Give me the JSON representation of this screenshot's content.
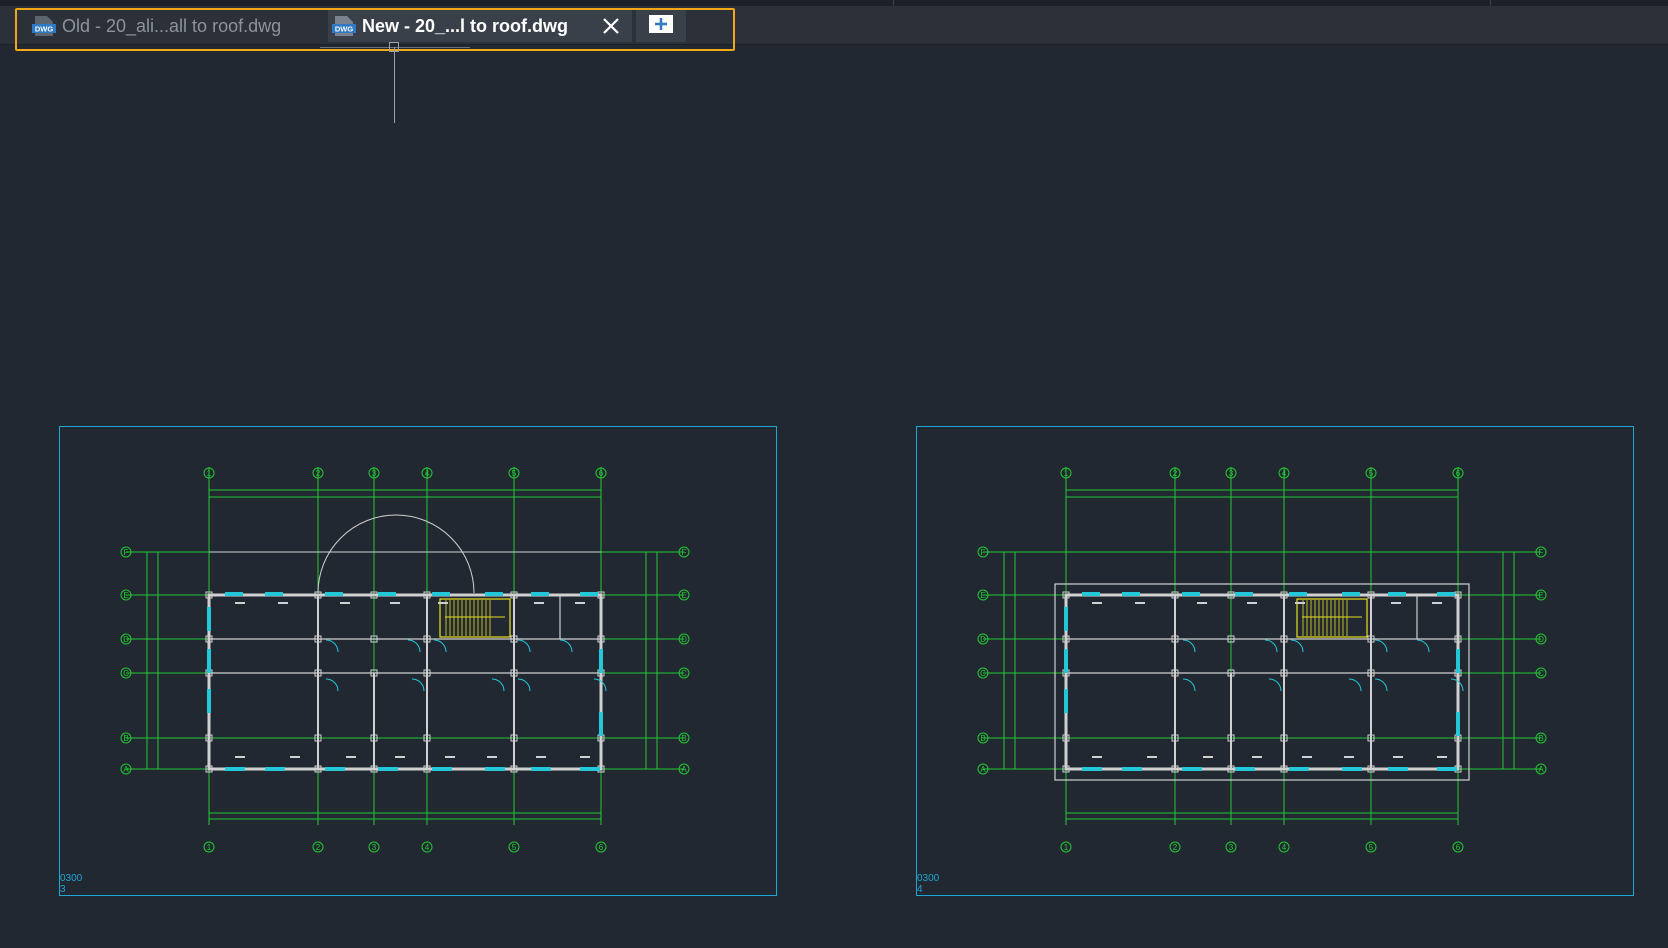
{
  "tabs": [
    {
      "label": "Old - 20_ali...all to roof.dwg",
      "active": false,
      "icon": "dwg-file-icon"
    },
    {
      "label": "New - 20_...l to roof.dwg",
      "active": true,
      "icon": "dwg-file-icon"
    }
  ],
  "tab_icon_text": "DWG",
  "viewports": [
    {
      "scale": "0300",
      "number": "3"
    },
    {
      "scale": "0300",
      "number": "4"
    }
  ],
  "grid_labels": {
    "columns": [
      "1",
      "2",
      "3",
      "4",
      "5",
      "6"
    ],
    "rows": [
      "F",
      "E",
      "D",
      "C",
      "B",
      "A"
    ]
  },
  "colors": {
    "accent_highlight": "#f0a818",
    "viewport_border": "#1ea6d4",
    "grid": "#22c832",
    "walls": "#d0d0d0",
    "stairs": "#e8e020",
    "doors": "#22c8d8"
  }
}
